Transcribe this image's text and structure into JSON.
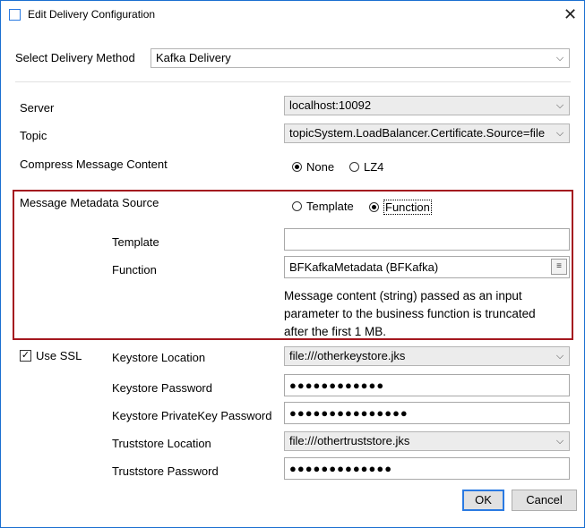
{
  "window": {
    "title": "Edit Delivery Configuration",
    "close_glyph": "✕"
  },
  "delivery": {
    "label": "Select Delivery Method",
    "value": "Kafka Delivery"
  },
  "server": {
    "label": "Server",
    "value": "localhost:10092"
  },
  "topic": {
    "label": "Topic",
    "value": "topicSystem.LoadBalancer.Certificate.Source=file"
  },
  "compress": {
    "label": "Compress Message Content",
    "options": [
      "None",
      "LZ4"
    ],
    "selected": "None"
  },
  "metadata": {
    "label": "Message Metadata Source",
    "options": [
      "Template",
      "Function"
    ],
    "selected": "Function",
    "template_label": "Template",
    "template_value": "",
    "function_label": "Function",
    "function_value": "BFKafkaMetadata (BFKafka)",
    "description": "Message content (string) passed as an input parameter to the business function is truncated after the first 1 MB."
  },
  "ssl": {
    "use_label": "Use SSL",
    "checked": true,
    "keystore_location_label": "Keystore Location",
    "keystore_location_value": "file:///otherkeystore.jks",
    "keystore_password_label": "Keystore Password",
    "keystore_password_value": "●●●●●●●●●●●●",
    "keystore_privatekey_label": "Keystore PrivateKey Password",
    "keystore_privatekey_value": "●●●●●●●●●●●●●●●",
    "truststore_location_label": "Truststore Location",
    "truststore_location_value": "file:///othertruststore.jks",
    "truststore_password_label": "Truststore Password",
    "truststore_password_value": "●●●●●●●●●●●●●"
  },
  "buttons": {
    "ok": "OK",
    "cancel": "Cancel"
  },
  "icons": {
    "dropdown": "chevron-down-icon",
    "function_picker": "list-icon"
  },
  "colors": {
    "accent": "#2a7ae2",
    "group_border": "#a4181f"
  }
}
